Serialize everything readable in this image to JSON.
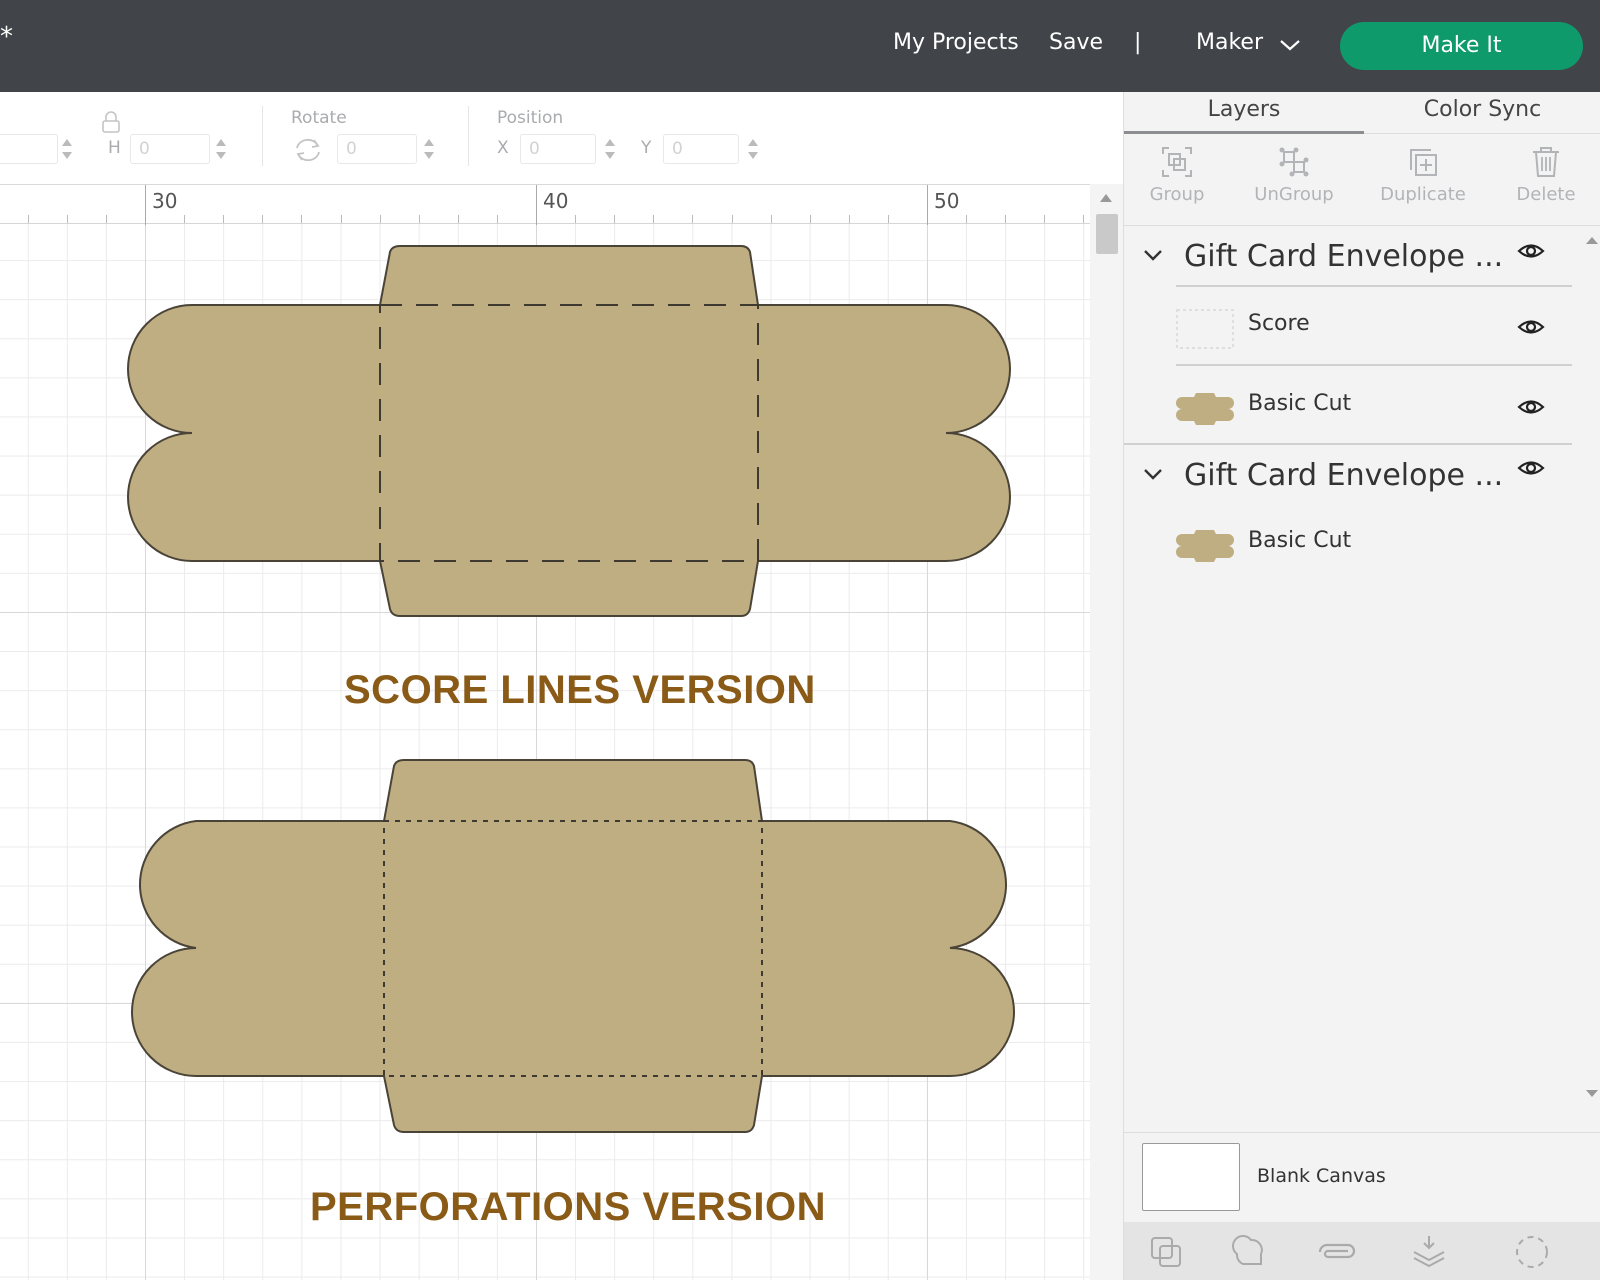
{
  "header": {
    "unsaved_marker": "*",
    "my_projects": "My Projects",
    "save": "Save",
    "separator": "|",
    "machine": "Maker",
    "make_it": "Make It",
    "accent_color": "#0f9a6c"
  },
  "toolbar": {
    "h_label": "H",
    "h_value": "0",
    "rotate_label": "Rotate",
    "rotate_value": "0",
    "position_label": "Position",
    "x_label": "X",
    "x_value": "0",
    "y_label": "Y",
    "y_value": "0"
  },
  "ruler": {
    "labels": [
      "30",
      "40",
      "50"
    ]
  },
  "canvas": {
    "shape_color": "#bfae82",
    "caption_color": "#8a5a17",
    "captions": {
      "score": "SCORE LINES VERSION",
      "perforations": "PERFORATIONS VERSION"
    }
  },
  "panel": {
    "tabs": [
      "Layers",
      "Color Sync"
    ],
    "tools": [
      "Group",
      "UnGroup",
      "Duplicate",
      "Delete"
    ],
    "groups": [
      {
        "name": "Gift Card Envelope ...",
        "children": [
          "Score",
          "Basic Cut"
        ]
      },
      {
        "name": "Gift Card Envelope ...",
        "children": [
          "Basic Cut"
        ]
      }
    ],
    "blank_canvas": "Blank Canvas"
  }
}
